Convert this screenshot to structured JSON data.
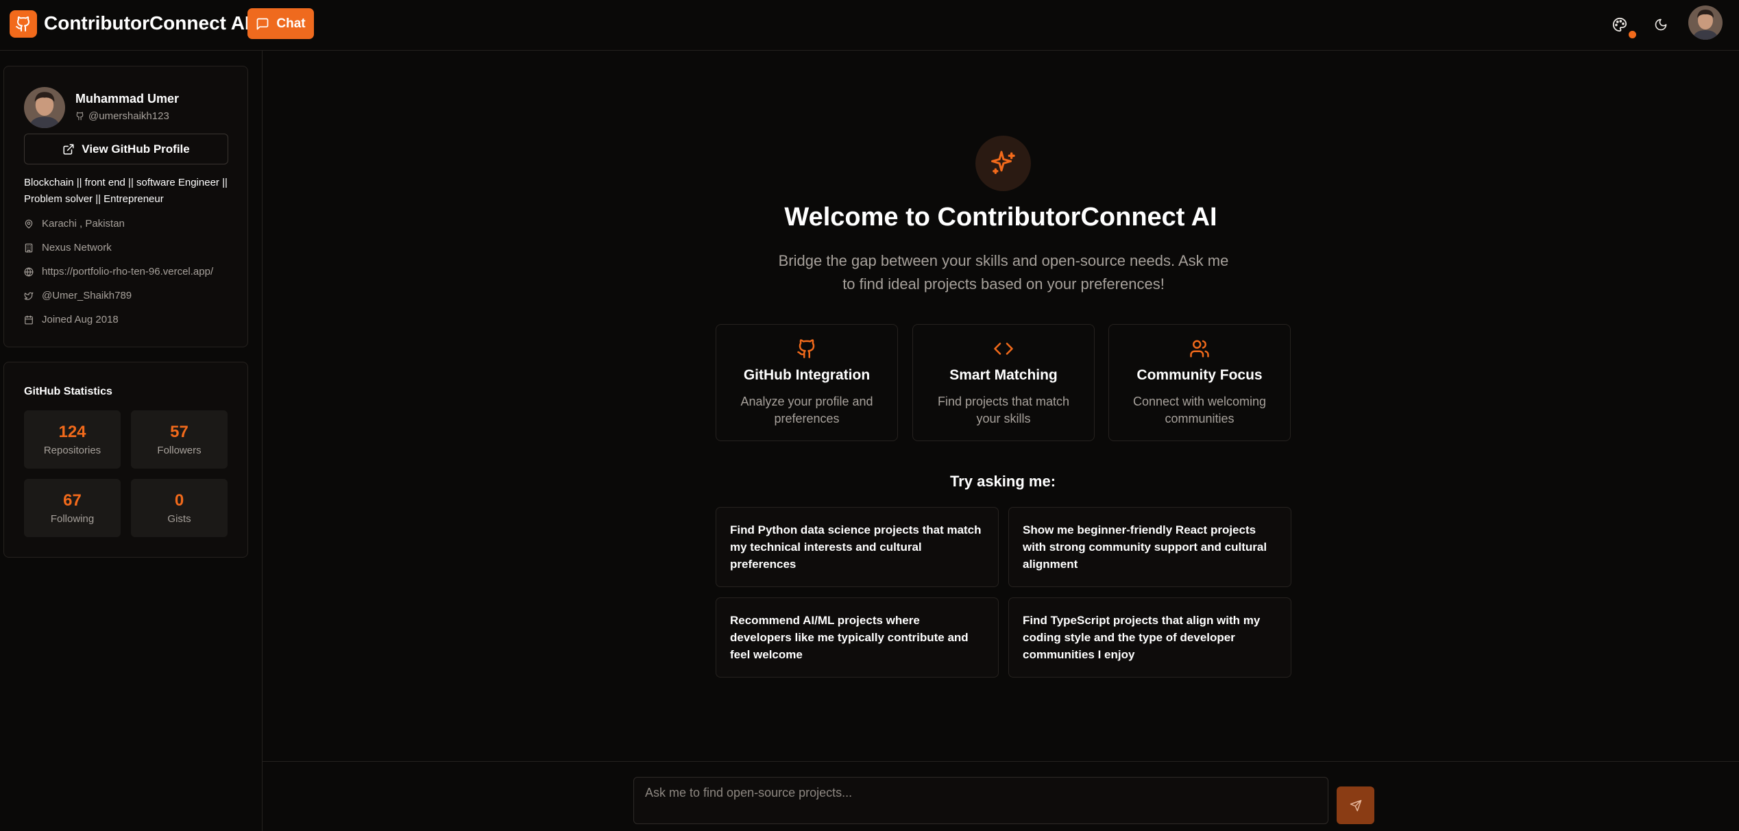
{
  "header": {
    "app_title": "ContributorConnect AI",
    "chat_label": "Chat",
    "logo_icon": "github-icon",
    "theme_icon": "palette-icon",
    "mode_icon": "moon-icon",
    "accent": "#f26a1b"
  },
  "profile": {
    "name": "Muhammad Umer",
    "handle": "@umershaikh123",
    "github_button": "View GitHub Profile",
    "bio": "Blockchain || front end || software Engineer || Problem solver || Entrepreneur",
    "location": "Karachi , Pakistan",
    "company": "Nexus Network",
    "website": "https://portfolio-rho-ten-96.vercel.app/",
    "twitter": "@Umer_Shaikh789",
    "joined": "Joined Aug 2018"
  },
  "stats": {
    "title": "GitHub Statistics",
    "items": [
      {
        "value": "124",
        "label": "Repositories"
      },
      {
        "value": "57",
        "label": "Followers"
      },
      {
        "value": "67",
        "label": "Following"
      },
      {
        "value": "0",
        "label": "Gists"
      }
    ]
  },
  "main": {
    "title": "Welcome to ContributorConnect AI",
    "subtitle": "Bridge the gap between your skills and open-source needs. Ask me to find ideal projects based on your preferences!",
    "features": [
      {
        "icon": "github-icon",
        "title": "GitHub Integration",
        "desc": "Analyze your profile and preferences"
      },
      {
        "icon": "code-icon",
        "title": "Smart Matching",
        "desc": "Find projects that match your skills"
      },
      {
        "icon": "users-icon",
        "title": "Community Focus",
        "desc": "Connect with welcoming communities"
      }
    ],
    "try_label": "Try asking me:",
    "suggestions": [
      "Find Python data science projects that match my technical interests and cultural preferences",
      "Show me beginner-friendly React projects with strong community support and cultural alignment",
      "Recommend AI/ML projects where developers like me typically contribute and feel welcome",
      "Find TypeScript projects that align with my coding style and the type of developer communities I enjoy"
    ]
  },
  "composer": {
    "placeholder": "Ask me to find open-source projects..."
  }
}
